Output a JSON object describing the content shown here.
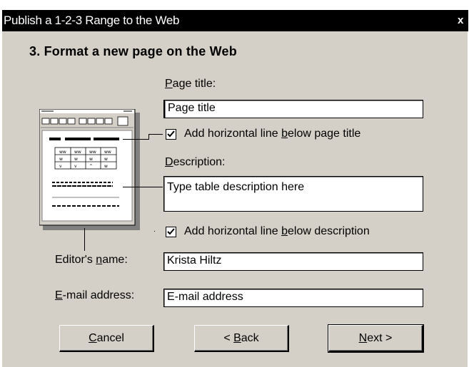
{
  "window": {
    "title": "Publish a 1-2-3 Range to the Web",
    "close_glyph": "x"
  },
  "step": {
    "heading": "3.  Format a new page on the Web"
  },
  "page_title": {
    "label_accel": "P",
    "label_rest": "age title:",
    "value": "Page title"
  },
  "hline_title": {
    "label_pre": "Add horizontal line ",
    "label_accel": "b",
    "label_post": "elow page title",
    "checked": true
  },
  "description": {
    "label_accel": "D",
    "label_rest": "escription:",
    "value": "Type table description here"
  },
  "hline_desc": {
    "label_pre": "Add horizontal line ",
    "label_accel": "b",
    "label_post": "elow description",
    "checked": true
  },
  "editor": {
    "label_pre": "Editor's ",
    "label_accel": "n",
    "label_post": "ame:",
    "value": "Krista Hiltz"
  },
  "email": {
    "label_accel": "E",
    "label_rest": "-mail address:",
    "value": "E-mail address"
  },
  "buttons": {
    "cancel_accel": "C",
    "cancel_rest": "ancel",
    "back_pre": "< ",
    "back_accel": "B",
    "back_rest": "ack",
    "next_accel": "N",
    "next_rest": "ext >"
  },
  "icons": {
    "thumbnail": "web-page-preview-icon",
    "checkbox": "checkmark-icon",
    "close": "close-icon"
  }
}
